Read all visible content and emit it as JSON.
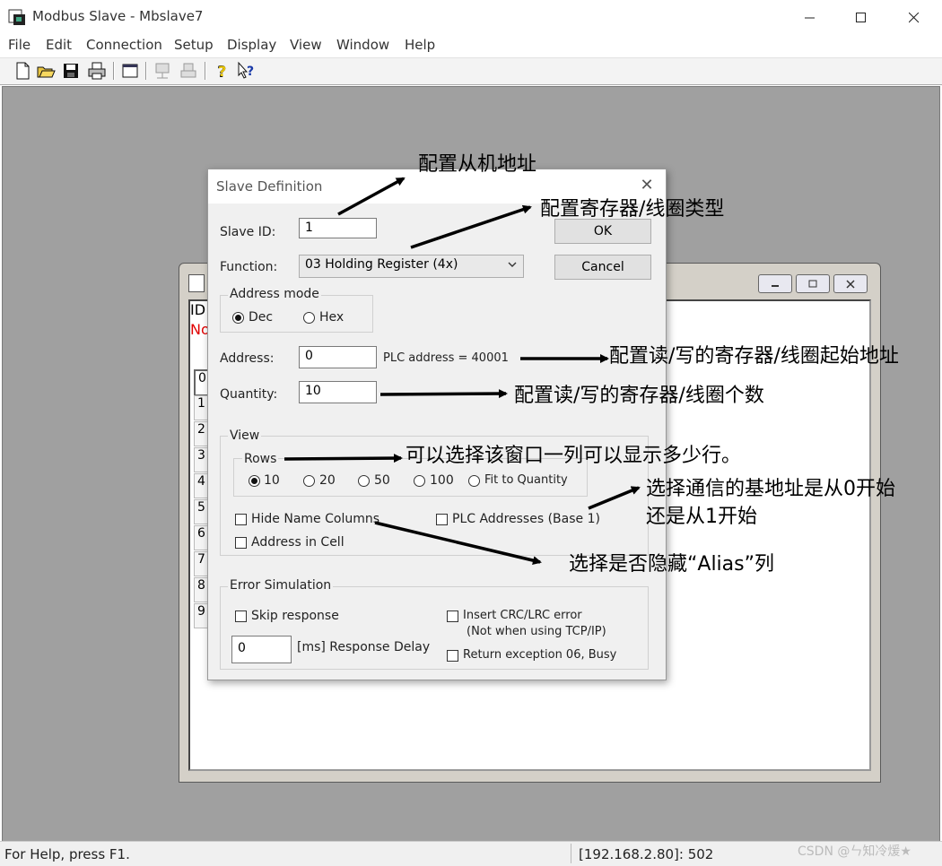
{
  "window": {
    "title": "Modbus Slave - Mbslave7",
    "minimize_icon": "minimize-icon",
    "maximize_icon": "maximize-icon",
    "close_icon": "close-icon"
  },
  "menu": [
    "File",
    "Edit",
    "Connection",
    "Setup",
    "Display",
    "View",
    "Window",
    "Help"
  ],
  "toolbar": [
    "new-doc-icon",
    "open-folder-icon",
    "save-icon",
    "print-icon",
    "window-icon",
    "connect-icon",
    "disconnect-icon",
    "help-icon",
    "context-help-icon"
  ],
  "child": {
    "id_label": "ID",
    "status_label": "No",
    "row_numbers": [
      "0",
      "1",
      "2",
      "3",
      "4",
      "5",
      "6",
      "7",
      "8",
      "9"
    ]
  },
  "dialog": {
    "title": "Slave Definition",
    "slave_id_label": "Slave ID:",
    "slave_id_value": "1",
    "function_label": "Function:",
    "function_value": "03 Holding Register (4x)",
    "ok": "OK",
    "cancel": "Cancel",
    "address_mode": {
      "title": "Address mode",
      "dec": "Dec",
      "hex": "Hex",
      "selected": "Dec"
    },
    "address_label": "Address:",
    "address_value": "0",
    "plc_address": "PLC address = 40001",
    "quantity_label": "Quantity:",
    "quantity_value": "10",
    "view": {
      "title": "View",
      "rows_title": "Rows",
      "rows_options": [
        "10",
        "20",
        "50",
        "100",
        "Fit to Quantity"
      ],
      "rows_selected": "10",
      "hide_name_columns": "Hide Name Columns",
      "plc_addresses_base1": "PLC Addresses (Base 1)",
      "address_in_cell": "Address in Cell"
    },
    "error_sim": {
      "title": "Error Simulation",
      "skip_response": "Skip response",
      "delay_value": "0",
      "delay_label": "[ms] Response Delay",
      "insert_crc": "Insert CRC/LRC error",
      "insert_crc_note": "(Not when using TCP/IP)",
      "return_exception": "Return exception 06, Busy"
    }
  },
  "annotations": {
    "slave_addr": "配置从机地址",
    "reg_type": "配置寄存器/线圈类型",
    "start_addr": "配置读/写的寄存器/线圈起始地址",
    "count": "配置读/写的寄存器/线圈个数",
    "rows": "可以选择该窗口一列可以显示多少行。",
    "base_line1": "选择通信的基地址是从0开始",
    "base_line2": "还是从1开始",
    "alias": "选择是否隐藏“Alias”列"
  },
  "status": {
    "help": "For Help, press F1.",
    "connection": "[192.168.2.80]: 502",
    "watermark": "CSDN @ㄣ知冷煖★"
  }
}
